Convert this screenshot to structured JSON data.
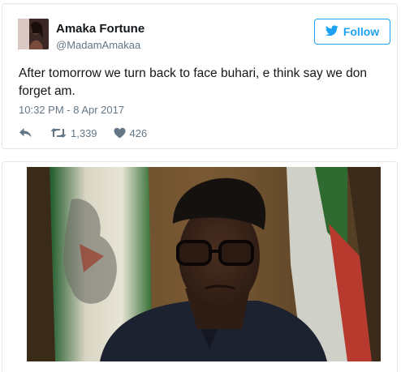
{
  "tweet": {
    "display_name": "Amaka Fortune",
    "handle": "@MadamAmakaa",
    "follow_label": "Follow",
    "text": "After tomorrow we turn back to face buhari, e think say we don forget am.",
    "timestamp": "10:32 PM - 8 Apr 2017",
    "retweet_count": "1,339",
    "like_count": "426",
    "icons": {
      "follow": "twitter-bird-icon",
      "reply": "reply-icon",
      "retweet": "retweet-icon",
      "like": "heart-icon"
    }
  },
  "colors": {
    "accent": "#1da1f2",
    "secondary_text": "#657786",
    "border": "#e1e8ed"
  }
}
